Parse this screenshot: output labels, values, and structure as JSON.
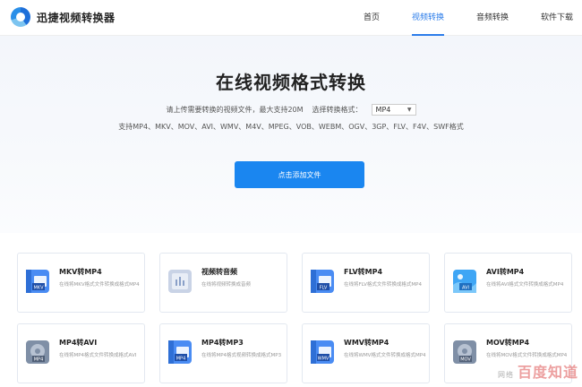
{
  "app": {
    "title": "迅捷视频转换器"
  },
  "nav": [
    {
      "label": "首页",
      "active": false
    },
    {
      "label": "视频转换",
      "active": true
    },
    {
      "label": "音频转换",
      "active": false
    },
    {
      "label": "软件下载",
      "active": false
    }
  ],
  "hero": {
    "title": "在线视频格式转换",
    "upload_hint": "请上传需要转换的视频文件，最大支持20M",
    "select_label": "选择转换格式：",
    "selected_format": "MP4",
    "supported": "支持MP4、MKV、MOV、AVI、WMV、M4V、MPEG、VOB、WEBM、OGV、3GP、FLV、F4V、SWF格式",
    "add_button": "点击添加文件"
  },
  "cards": [
    {
      "title": "MKV转MP4",
      "desc": "在线将MKV格式文件转换成格式MP4",
      "icon": "mkv-file-icon"
    },
    {
      "title": "视频转音频",
      "desc": "在线将视频转换成音频",
      "icon": "audio-file-icon"
    },
    {
      "title": "FLV转MP4",
      "desc": "在线将FLV格式文件转换成格式MP4",
      "icon": "flv-file-icon"
    },
    {
      "title": "AVI转MP4",
      "desc": "在线将AVI格式文件转换成格式MP4",
      "icon": "avi-file-icon"
    },
    {
      "title": "MP4转AVI",
      "desc": "在线将MP4格式文件转换成格式AVI",
      "icon": "mp4-file-icon"
    },
    {
      "title": "MP4转MP3",
      "desc": "在线将MP4格式视频转换成格式MP3",
      "icon": "mp4-file-icon"
    },
    {
      "title": "WMV转MP4",
      "desc": "在线将WMV格式文件转换成格式MP4",
      "icon": "wmv-file-icon"
    },
    {
      "title": "MOV转MP4",
      "desc": "在线将MOV格式文件转换成格式MP4",
      "icon": "mov-file-icon"
    }
  ],
  "watermark": {
    "small": "网络",
    "main": "百度知道"
  }
}
